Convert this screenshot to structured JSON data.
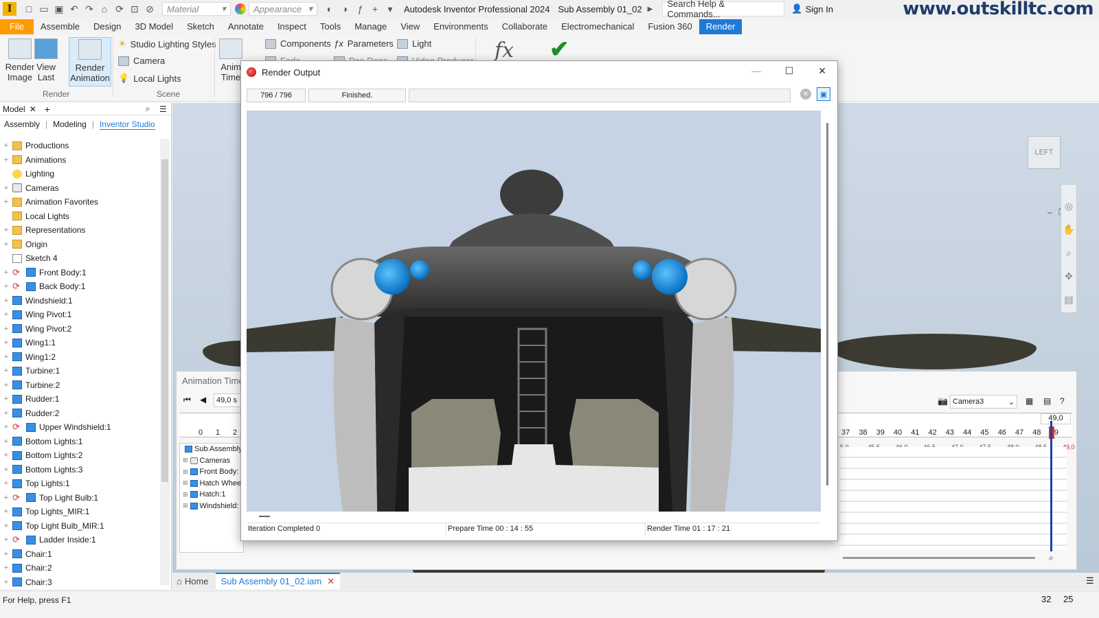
{
  "titlebar": {
    "app_icon": "I",
    "material_placeholder": "Material",
    "appearance_placeholder": "Appearance",
    "title": "Autodesk Inventor Professional 2024",
    "document": "Sub Assembly 01_02",
    "search": "Search Help & Commands...",
    "sign_in": "Sign In",
    "watermark": "www.outskilltc.com"
  },
  "menu": {
    "tabs": [
      "File",
      "Assemble",
      "Design",
      "3D Model",
      "Sketch",
      "Annotate",
      "Inspect",
      "Tools",
      "Manage",
      "View",
      "Environments",
      "Collaborate",
      "Electromechanical",
      "Fusion 360",
      "Render"
    ],
    "active": "Render"
  },
  "ribbon": {
    "render_image": "Render\nImage",
    "view_last": "View\nLast",
    "render_animation": "Render\nAnimation",
    "group_render": "Render",
    "studio_lighting": "Studio Lighting Styles",
    "camera": "Camera",
    "local_lights": "Local Lights",
    "group_scene": "Scene",
    "animate": "Anim\nTime",
    "components": "Components",
    "parameters": "Parameters",
    "light": "Light",
    "fade": "Fade",
    "pos_reps": "Pos Reps",
    "video_producer": "Video Producer",
    "fx": "fx"
  },
  "browser": {
    "header_title": "Model",
    "tabs": [
      "Assembly",
      "Modeling",
      "Inventor Studio"
    ],
    "active_tab": "Inventor Studio",
    "items": [
      {
        "label": "Productions",
        "icon": "folder",
        "exp": true,
        "link": false
      },
      {
        "label": "Animations",
        "icon": "folder",
        "exp": true,
        "link": false
      },
      {
        "label": "Lighting",
        "icon": "sun",
        "exp": false,
        "link": false
      },
      {
        "label": "Cameras",
        "icon": "cam",
        "exp": true,
        "link": false
      },
      {
        "label": "Animation Favorites",
        "icon": "folder",
        "exp": true,
        "link": false
      },
      {
        "label": "Local Lights",
        "icon": "folder",
        "exp": false,
        "link": false
      },
      {
        "label": "Representations",
        "icon": "folder",
        "exp": true,
        "link": false
      },
      {
        "label": "Origin",
        "icon": "folder",
        "exp": true,
        "link": false
      },
      {
        "label": "Sketch 4",
        "icon": "sketch",
        "exp": false,
        "link": false
      },
      {
        "label": "Front Body:1",
        "icon": "part",
        "exp": true,
        "link": true
      },
      {
        "label": "Back Body:1",
        "icon": "part",
        "exp": true,
        "link": true
      },
      {
        "label": "Windshield:1",
        "icon": "part",
        "exp": true,
        "link": false
      },
      {
        "label": "Wing Pivot:1",
        "icon": "part",
        "exp": true,
        "link": false
      },
      {
        "label": "Wing Pivot:2",
        "icon": "part",
        "exp": true,
        "link": false
      },
      {
        "label": "Wing1:1",
        "icon": "part",
        "exp": true,
        "link": false
      },
      {
        "label": "Wing1:2",
        "icon": "part",
        "exp": true,
        "link": false
      },
      {
        "label": "Turbine:1",
        "icon": "part",
        "exp": true,
        "link": false
      },
      {
        "label": "Turbine:2",
        "icon": "part",
        "exp": true,
        "link": false
      },
      {
        "label": "Rudder:1",
        "icon": "part",
        "exp": true,
        "link": false
      },
      {
        "label": "Rudder:2",
        "icon": "part",
        "exp": true,
        "link": false
      },
      {
        "label": "Upper Windshield:1",
        "icon": "part",
        "exp": true,
        "link": true
      },
      {
        "label": "Bottom Lights:1",
        "icon": "part",
        "exp": true,
        "link": false
      },
      {
        "label": "Bottom Lights:2",
        "icon": "part",
        "exp": true,
        "link": false
      },
      {
        "label": "Bottom Lights:3",
        "icon": "part",
        "exp": true,
        "link": false
      },
      {
        "label": "Top Lights:1",
        "icon": "part",
        "exp": true,
        "link": false
      },
      {
        "label": "Top Light Bulb:1",
        "icon": "part",
        "exp": true,
        "link": true
      },
      {
        "label": "Top Lights_MIR:1",
        "icon": "part",
        "exp": true,
        "link": false
      },
      {
        "label": "Top Light Bulb_MIR:1",
        "icon": "part",
        "exp": true,
        "link": false
      },
      {
        "label": "Ladder Inside:1",
        "icon": "part",
        "exp": true,
        "link": true
      },
      {
        "label": "Chair:1",
        "icon": "part",
        "exp": true,
        "link": false
      },
      {
        "label": "Chair:2",
        "icon": "part",
        "exp": true,
        "link": false
      },
      {
        "label": "Chair:3",
        "icon": "part",
        "exp": true,
        "link": false
      }
    ]
  },
  "viewport": {
    "viewcube_label": "LEFT"
  },
  "timeline": {
    "title": "Animation Time",
    "time_value": "49,0 s",
    "camera": "Camera3",
    "end_value": "49,0",
    "left_ticks": [
      "0",
      "1",
      "2"
    ],
    "right_ticks": [
      "37",
      "38",
      "39",
      "40",
      "41",
      "42",
      "43",
      "44",
      "45",
      "46",
      "47",
      "48",
      "49"
    ],
    "sub_ticks": [
      "5,0",
      "45,5",
      "46,0",
      "46,5",
      "47,0",
      "47,5",
      "48,0",
      "48,5",
      "49,0"
    ],
    "tree": [
      {
        "label": "Sub Assembly",
        "icon": "part"
      },
      {
        "label": "Cameras",
        "icon": "cam"
      },
      {
        "label": "Front Body:",
        "icon": "part"
      },
      {
        "label": "Hatch Whee",
        "icon": "part"
      },
      {
        "label": "Hatch:1",
        "icon": "part"
      },
      {
        "label": "Windshield:",
        "icon": "part"
      }
    ]
  },
  "dialog": {
    "title": "Render Output",
    "progress": "796 / 796",
    "status": "Finished.",
    "iteration": "Iteration Completed  0",
    "prepare_time": "Prepare Time  00 : 14 : 55",
    "render_time": "Render Time  01 : 17 : 21"
  },
  "doctabs": {
    "home": "Home",
    "active": "Sub Assembly 01_02.iam"
  },
  "statusbar": {
    "help": "For Help, press F1",
    "count1": "32",
    "count2": "25"
  }
}
